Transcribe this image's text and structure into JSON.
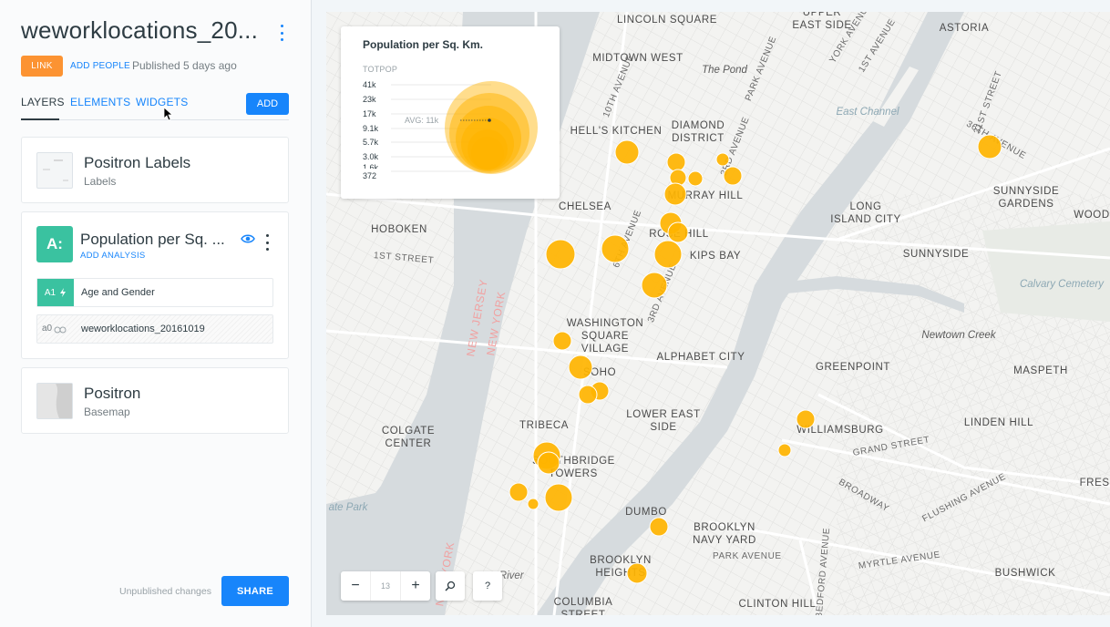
{
  "header": {
    "title": "weworklocations_20...",
    "link_label": "LINK",
    "add_people_label": "ADD PEOPLE",
    "published_text": "Published 5 days ago"
  },
  "tabs": {
    "layers": "LAYERS",
    "elements": "ELEMENTS",
    "widgets": "WIDGETS",
    "add_label": "ADD"
  },
  "layers": [
    {
      "title": "Positron Labels",
      "subtitle": "Labels"
    },
    {
      "badge": "A:",
      "title": "Population per Sq. ...",
      "add_analysis": "ADD ANALYSIS",
      "analysis_id": "A1",
      "analysis_name": "Age and Gender",
      "source_id": "a0",
      "source_name": "weworklocations_20161019"
    },
    {
      "title": "Positron",
      "subtitle": "Basemap"
    }
  ],
  "footer": {
    "status": "Unpublished changes",
    "share_label": "SHARE"
  },
  "legend": {
    "title": "Population per Sq. Km.",
    "field": "TOTPOP",
    "ticks": [
      "41k",
      "23k",
      "17k",
      "9.1k",
      "5.7k",
      "3.0k",
      "1.6k",
      "372"
    ],
    "avg_label": "AVG: 11k",
    "color": "#ffb400"
  },
  "map_controls": {
    "zoom_out": "−",
    "zoom_level": "13",
    "zoom_in": "+",
    "search_icon": "search-icon",
    "help": "?"
  },
  "map_labels": {
    "lincoln_square": "LINCOLN SQUARE",
    "upper_east_side": "UPPER EAST SIDE",
    "astoria": "ASTORIA",
    "midtown_west": "MIDTOWN WEST",
    "the_pond": "The Pond",
    "east_channel": "East Channel",
    "hells_kitchen": "HELL'S KITCHEN",
    "diamond_district": "DIAMOND DISTRICT",
    "murray_hill": "MURRAY HILL",
    "sunnyside_gardens": "SUNNYSIDE GARDENS",
    "wood": "WOOD",
    "chelsea": "CHELSEA",
    "long_island_city": "LONG ISLAND CITY",
    "hoboken": "HOBOKEN",
    "rose_hill": "ROSE HILL",
    "kips_bay": "KIPS BAY",
    "sunnyside": "SUNNYSIDE",
    "calvary_cemetery": "Calvary Cemetery",
    "washington_square_village": "WASHINGTON SQUARE VILLAGE",
    "newtown_creek": "Newtown Creek",
    "alphabet_city": "ALPHABET CITY",
    "soho": "SOHO",
    "greenpoint": "GREENPOINT",
    "maspeth": "MASPETH",
    "lower_east_side": "LOWER EAST SIDE",
    "tribeca": "TRIBECA",
    "williamsburg": "WILLIAMSBURG",
    "linden_hill": "LINDEN HILL",
    "colgate_center": "COLGATE CENTER",
    "southbridge_towers": "SOUTHBRIDGE TOWERS",
    "fresh": "FRESI",
    "state_park": "ate Park",
    "dumbo": "DUMBO",
    "brooklyn_navy_yard": "BROOKLYN NAVY YARD",
    "brooklyn_heights": "BROOKLYN HEIGHTS",
    "bushwick": "BUSHWICK",
    "columbia_street": "COLUMBIA STREET",
    "clinton_hill": "CLINTON HILL",
    "t_river": "t River"
  },
  "map_streets": {
    "tenth_avenue": "10TH AVENUE",
    "third_ave_n": "3RD AVENUE",
    "park_avenue": "PARK AVENUE",
    "york_avenue": "YORK AVENUE",
    "first_ave": "1ST AVENUE",
    "thirty_sixth": "36TH AVENUE",
    "thirty_first": "31ST STREET",
    "sixth_avenue": "6TH AVENUE",
    "third_ave_s": "3RD AVENUE",
    "first_street": "1ST STREET",
    "nj_new_york": "NEW JERSEY",
    "ny_new_york": "NEW YORK",
    "grand_street": "GRAND STREET",
    "broadway": "BROADWAY",
    "flushing_avenue": "FLUSHING AVENUE",
    "park_avenue_bk": "PARK AVENUE",
    "myrtle_avenue": "MYRTLE AVENUE",
    "bedford_avenue": "BEDFORD AVENUE",
    "ny_bottom": "NEW YORK"
  }
}
